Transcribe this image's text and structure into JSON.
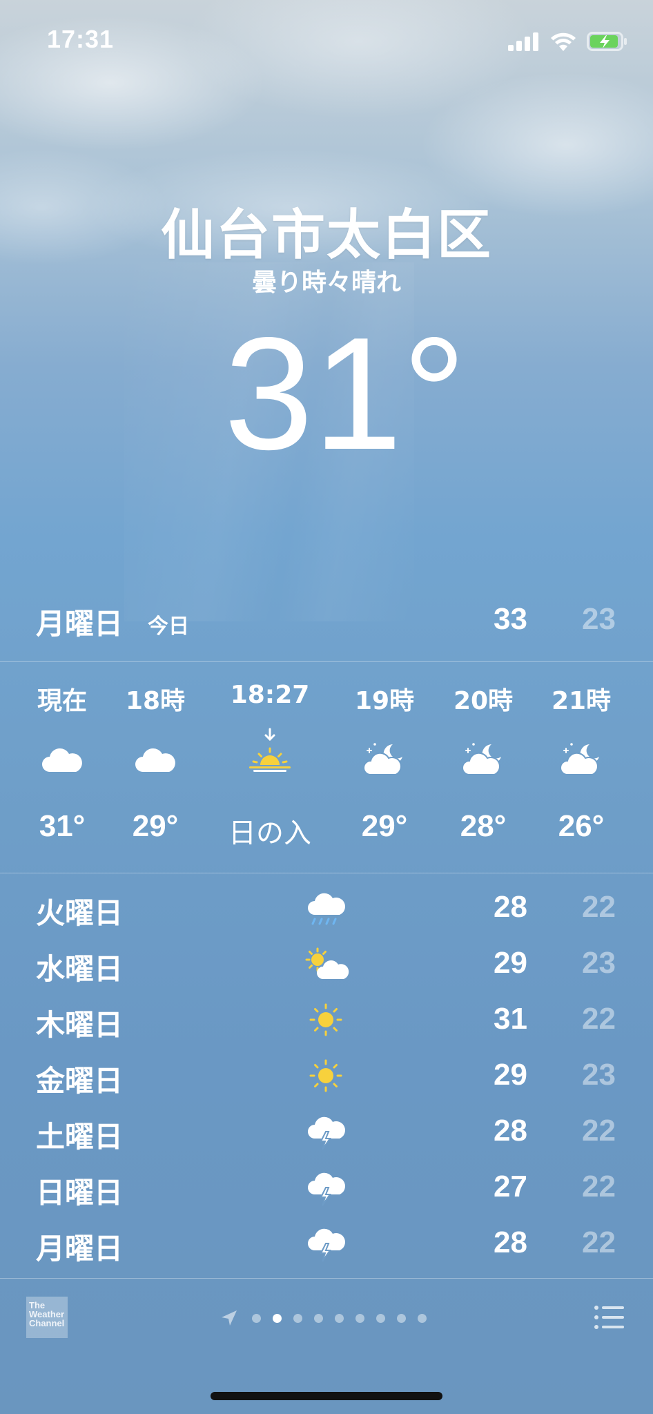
{
  "status_bar": {
    "time": "17:31"
  },
  "header": {
    "location": "仙台市太白区",
    "condition": "曇り時々晴れ",
    "temperature": "31°"
  },
  "today": {
    "day": "月曜日",
    "label": "今日",
    "high": "33",
    "low": "23"
  },
  "hourly": [
    {
      "time": "現在",
      "icon": "cloud-icon",
      "temp": "31°"
    },
    {
      "time": "18時",
      "icon": "cloud-icon",
      "temp": "29°"
    },
    {
      "time": "18:27",
      "icon": "sunset-icon",
      "temp": "日の入"
    },
    {
      "time": "19時",
      "icon": "cloud-moon-icon",
      "temp": "29°"
    },
    {
      "time": "20時",
      "icon": "cloud-moon-icon",
      "temp": "28°"
    },
    {
      "time": "21時",
      "icon": "cloud-moon-icon",
      "temp": "26°"
    }
  ],
  "daily": [
    {
      "day": "火曜日",
      "icon": "cloud-rain-icon",
      "high": "28",
      "low": "22"
    },
    {
      "day": "水曜日",
      "icon": "partly-sunny-icon",
      "high": "29",
      "low": "23"
    },
    {
      "day": "木曜日",
      "icon": "sun-icon",
      "high": "31",
      "low": "22"
    },
    {
      "day": "金曜日",
      "icon": "sun-icon",
      "high": "29",
      "low": "23"
    },
    {
      "day": "土曜日",
      "icon": "thunderstorm-icon",
      "high": "28",
      "low": "22"
    },
    {
      "day": "日曜日",
      "icon": "thunderstorm-icon",
      "high": "27",
      "low": "22"
    },
    {
      "day": "月曜日",
      "icon": "thunderstorm-icon",
      "high": "28",
      "low": "22"
    }
  ],
  "footer": {
    "logo_lines": [
      "The",
      "Weather",
      "Channel"
    ],
    "page_count": 9,
    "active_page": 1
  },
  "colors": {
    "sun": "#f7d13c",
    "rain": "#6fb6f0",
    "low_temp": "rgba(255,255,255,0.45)"
  }
}
